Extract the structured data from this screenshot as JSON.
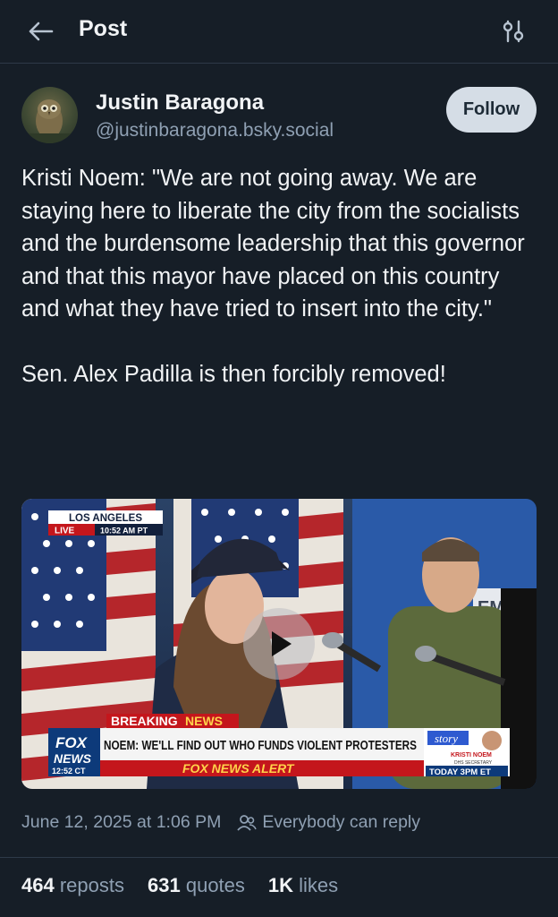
{
  "header": {
    "title": "Post",
    "back_icon": "arrow-left-icon",
    "settings_icon": "sliders-icon"
  },
  "author": {
    "name": "Justin Baragona",
    "handle": "@justinbaragona.bsky.social",
    "follow_label": "Follow"
  },
  "post": {
    "paragraphs": [
      "Kristi Noem: \"We are not going away. We are staying here to liberate the city from the socialists and the burdensome leadership that this governor and that this mayor have placed on this country and what they have tried to insert into the city.\"",
      "Sen. Alex Padilla is then forcibly removed!"
    ]
  },
  "video": {
    "location": "LOS ANGELES",
    "live_label": "LIVE",
    "live_time": "10:52 AM PT",
    "breaking_label": "BREAKING",
    "breaking_label2": "NEWS",
    "headline": "NOEM: WE'LL FIND OUT WHO FUNDS VIOLENT PROTESTERS",
    "alert_label": "FOX NEWS ALERT",
    "network_line1": "FOX",
    "network_line2": "NEWS",
    "network_time": "12:52 CT",
    "story_label": "story",
    "guest_name": "KRISTI NOEM",
    "guest_title": "DHS SECRETARY",
    "promo": "TODAY 3PM ET",
    "backdrop_text": "EMIL"
  },
  "meta": {
    "timestamp": "June 12, 2025 at 1:06 PM",
    "reply_setting": "Everybody can reply"
  },
  "stats": {
    "reposts_count": "464",
    "reposts_label": "reposts",
    "quotes_count": "631",
    "quotes_label": "quotes",
    "likes_count": "1K",
    "likes_label": "likes"
  },
  "colors": {
    "background": "#161e27",
    "text": "#f1f3f5",
    "muted": "#8fa0b3",
    "follow_bg": "#d5dde6",
    "fox_red": "#c4161c",
    "fox_blue": "#0d3a7a"
  }
}
